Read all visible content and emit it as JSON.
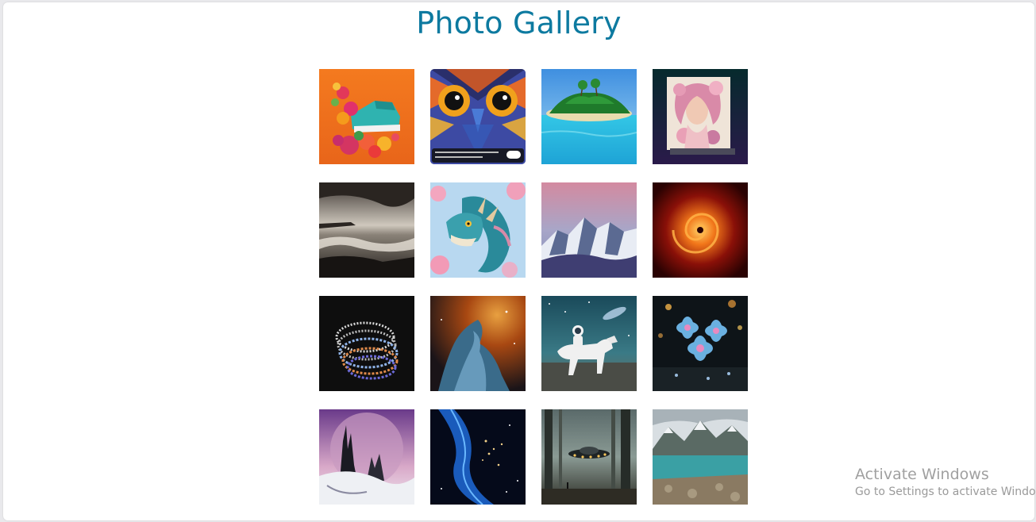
{
  "page": {
    "title": "Photo Gallery"
  },
  "gallery": {
    "photos": [
      {
        "subject": "sneaker-with-flowers"
      },
      {
        "subject": "owl-face-closeup",
        "caption": "A close-up of an owl with vibrant detailed feathers",
        "caption_button": "View"
      },
      {
        "subject": "tropical-island"
      },
      {
        "subject": "floral-woman-portrait"
      },
      {
        "subject": "stormy-sea-monochrome"
      },
      {
        "subject": "dragon-with-blossoms"
      },
      {
        "subject": "snowy-mountains-pink-sky"
      },
      {
        "subject": "fiery-swirl"
      },
      {
        "subject": "spiral-of-images"
      },
      {
        "subject": "nebula-pillars"
      },
      {
        "subject": "astronaut-riding-horse"
      },
      {
        "subject": "blue-flowers-bokeh"
      },
      {
        "subject": "fantasy-castle-planet"
      },
      {
        "subject": "blue-galaxy-stars"
      },
      {
        "subject": "ufo-in-forest"
      },
      {
        "subject": "mountain-lake"
      }
    ]
  },
  "watermark": {
    "line1": "Activate Windows",
    "line2": "Go to Settings to activate Windows."
  },
  "colors": {
    "title": "#0d7aa0",
    "background": "#ffffff"
  }
}
